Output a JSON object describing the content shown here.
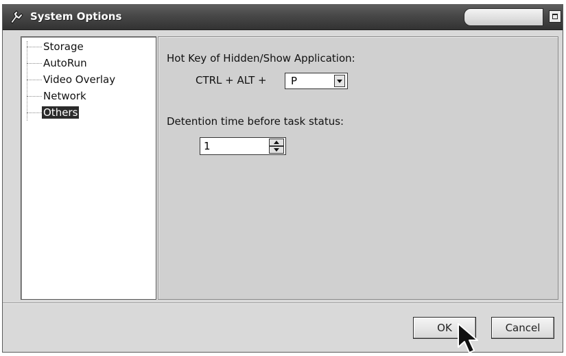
{
  "window": {
    "title": "System Options"
  },
  "tree": {
    "items": [
      {
        "label": "Storage"
      },
      {
        "label": "AutoRun"
      },
      {
        "label": "Video Overlay"
      },
      {
        "label": "Network"
      },
      {
        "label": "Others"
      }
    ],
    "selected": "Others"
  },
  "panel": {
    "hotkey_label": "Hot Key of Hidden/Show Application:",
    "hotkey_prefix": "CTRL + ALT +",
    "hotkey_value": "P",
    "detention_label": "Detention time before task status:",
    "detention_value": "1"
  },
  "buttons": {
    "ok": "OK",
    "cancel": "Cancel"
  },
  "icons": {
    "app": "tool-icon",
    "maximize": "maximize-icon",
    "dropdown": "chevron-down-icon",
    "spin_up": "arrow-up-icon",
    "spin_down": "arrow-down-icon",
    "cursor": "mouse-pointer-icon"
  }
}
